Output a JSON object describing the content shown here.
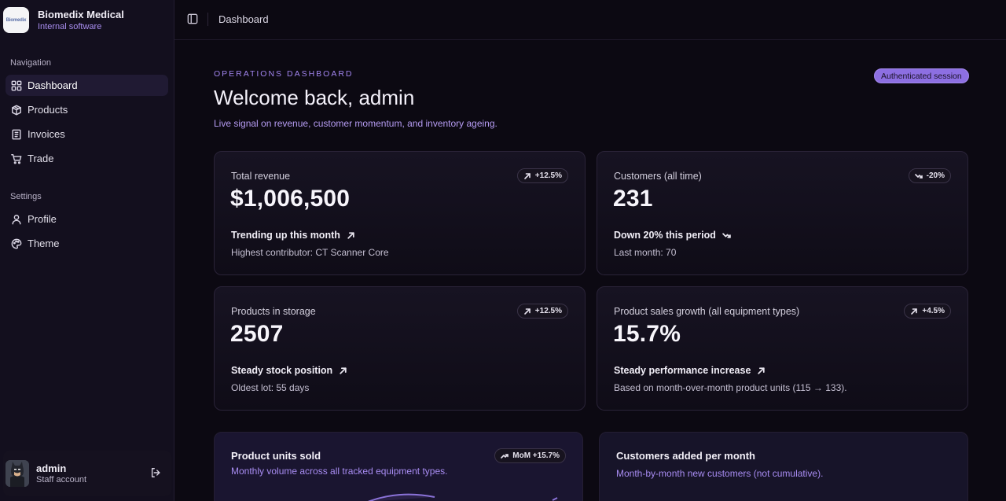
{
  "brand": {
    "name": "Biomedix Medical",
    "subtitle": "Internal software",
    "logo_text": "Biomedix"
  },
  "sidebar": {
    "nav_heading": "Navigation",
    "nav_items": [
      {
        "label": "Dashboard",
        "icon": "grid-icon",
        "active": true
      },
      {
        "label": "Products",
        "icon": "package-icon"
      },
      {
        "label": "Invoices",
        "icon": "receipt-icon"
      },
      {
        "label": "Trade",
        "icon": "cart-icon"
      }
    ],
    "settings_heading": "Settings",
    "settings_items": [
      {
        "label": "Profile",
        "icon": "user-icon"
      },
      {
        "label": "Theme",
        "icon": "palette-icon"
      }
    ],
    "user": {
      "name": "admin",
      "role": "Staff account"
    }
  },
  "topbar": {
    "breadcrumb": "Dashboard"
  },
  "header": {
    "eyebrow": "OPERATIONS DASHBOARD",
    "title": "Welcome back, admin",
    "subtitle": "Live signal on revenue, customer momentum, and inventory ageing.",
    "badge": "Authenticated session"
  },
  "stats": [
    {
      "label": "Total revenue",
      "value": "$1,006,500",
      "delta": "+12.5%",
      "direction": "up",
      "trend": "Trending up this month",
      "note": "Highest contributor: CT Scanner Core"
    },
    {
      "label": "Customers (all time)",
      "value": "231",
      "delta": "-20%",
      "direction": "down",
      "trend": "Down 20% this period",
      "note": "Last month: 70"
    },
    {
      "label": "Products in storage",
      "value": "2507",
      "delta": "+12.5%",
      "direction": "up",
      "trend": "Steady stock position",
      "note": "Oldest lot: 55 days"
    },
    {
      "label": "Product sales growth (all equipment types)",
      "value": "15.7%",
      "delta": "+4.5%",
      "direction": "up",
      "trend": "Steady performance increase",
      "note": "Based on month-over-month product units (115 → 133)."
    }
  ],
  "charts": [
    {
      "title": "Product units sold",
      "subtitle": "Monthly volume across all tracked equipment types.",
      "badge": "MoM +15.7%"
    },
    {
      "title": "Customers added per month",
      "subtitle": "Month-by-month new customers (not cumulative)."
    }
  ],
  "colors": {
    "accent": "#a184ee",
    "badge_bg": "#8d6fe2",
    "background": "#0c0912",
    "sidebar_bg": "#130f1e"
  }
}
